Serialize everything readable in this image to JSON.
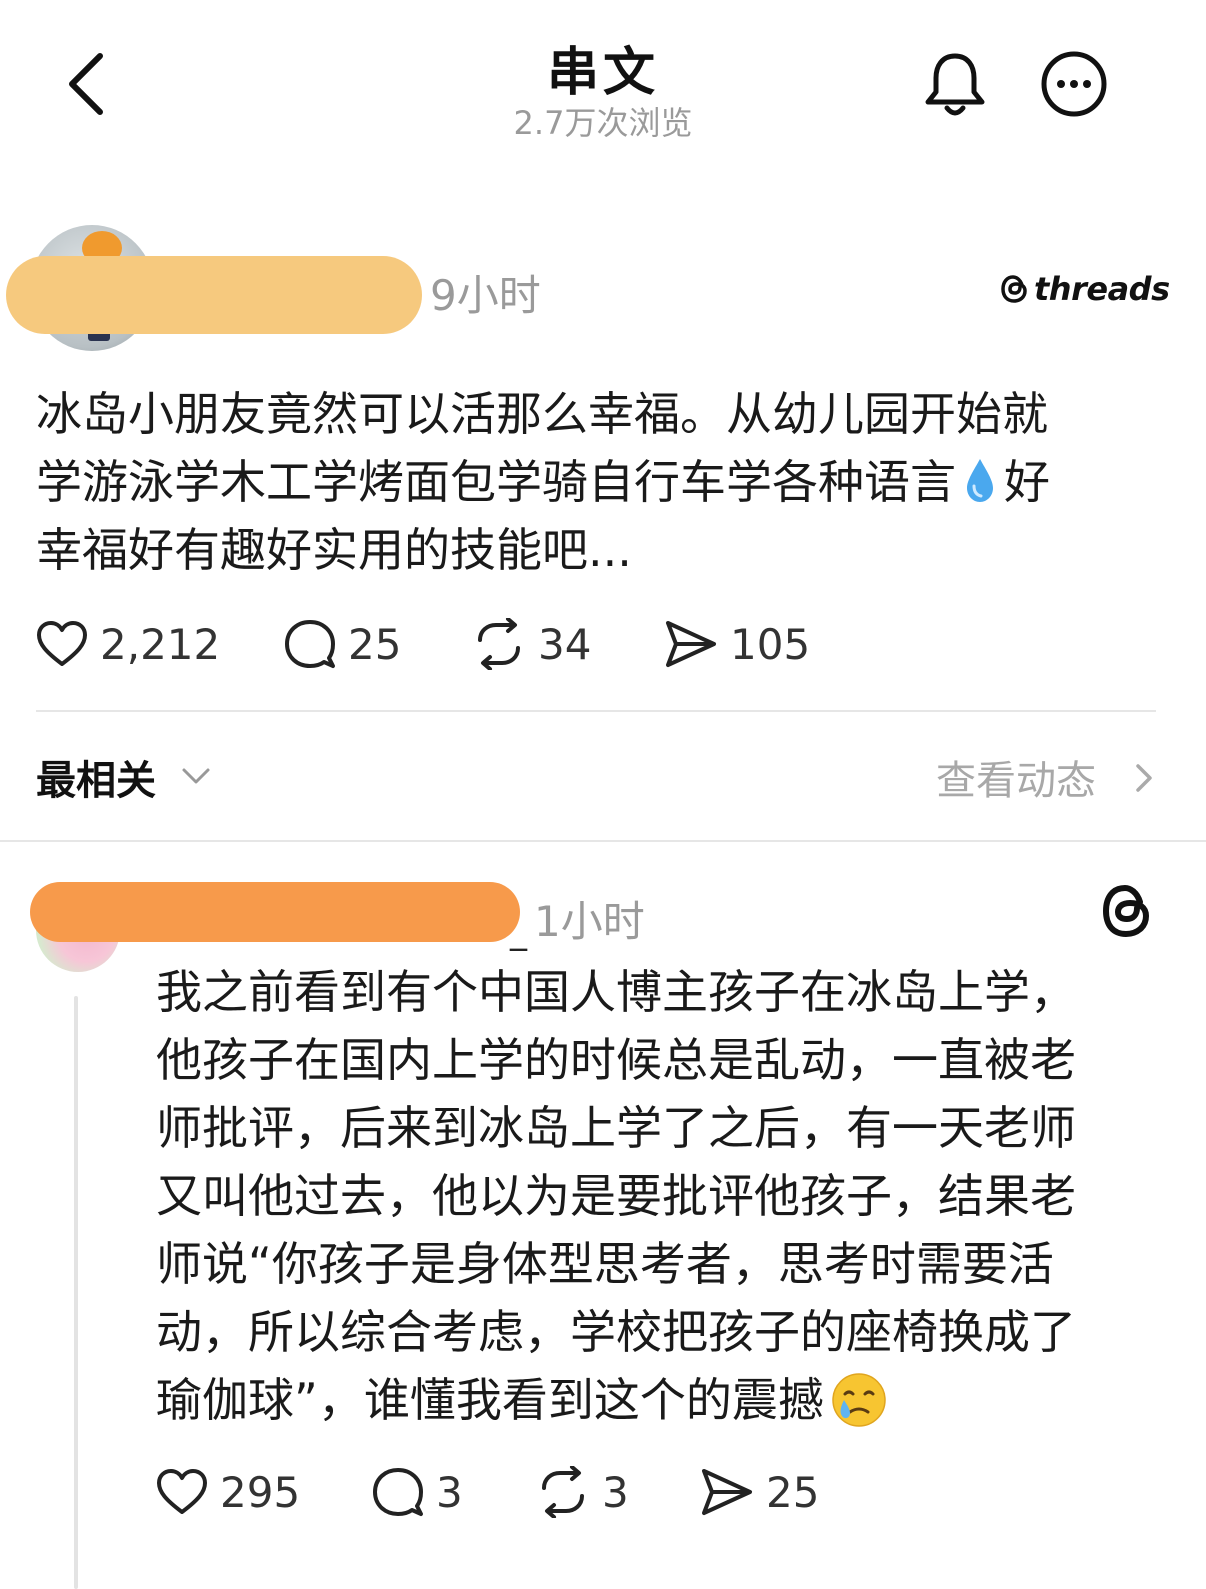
{
  "header": {
    "title": "串文",
    "views": "2.7万次浏览"
  },
  "post": {
    "time": "9小时",
    "brand": "threads",
    "text_line1": "冰岛小朋友竟然可以活那么幸福。从幼儿园开始就",
    "text_line2a": "学游泳学木工学烤面包学骑自行车学各种语言",
    "text_line2b": "好",
    "text_line3": "幸福好有趣好实用的技能吧...",
    "stats": {
      "likes": "2,212",
      "replies": "25",
      "reposts": "34",
      "shares": "105"
    }
  },
  "sort": {
    "label": "最相关",
    "activity_label": "查看动态"
  },
  "reply": {
    "time": "1小时",
    "underscore": "_",
    "text_lines": [
      "我之前看到有个中国人博主孩子在冰岛上学，",
      "他孩子在国内上学的时候总是乱动，一直被老",
      "师批评，后来到冰岛上学了之后，有一天老师",
      "又叫他过去，他以为是要批评他孩子，结果老",
      "师说“你孩子是身体型思考者，思考时需要活",
      "动，所以综合考虑，学校把孩子的座椅换成了"
    ],
    "text_last": "瑜伽球”，谁懂我看到这个的震撼",
    "stats": {
      "likes": "295",
      "replies": "3",
      "reposts": "3",
      "shares": "25"
    }
  },
  "colors": {
    "redact_main": "#f6c97e",
    "redact_reply": "#f79a4b",
    "muted_text": "#9a9a9a"
  },
  "icons": {
    "back": "chevron-left-icon",
    "bell": "bell-icon",
    "more": "more-icon",
    "like": "heart-icon",
    "reply": "comment-icon",
    "repost": "repost-icon",
    "share": "send-icon"
  }
}
